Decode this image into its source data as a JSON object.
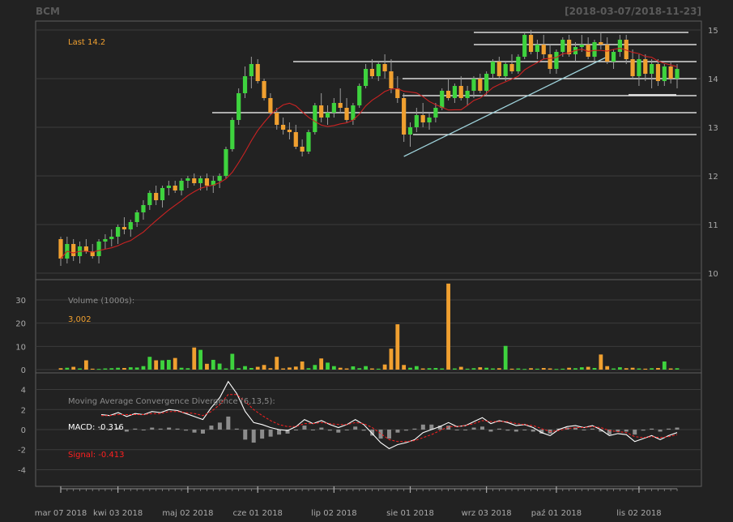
{
  "header": {
    "symbol": "BCM",
    "date_range": "[2018-03-07/2018-11-23]"
  },
  "colors": {
    "background": "#222222",
    "panel_border": "#5f5f5f",
    "grid": "#3c3c3c",
    "up_candle": "#3ed33e",
    "down_candle": "#f0a030",
    "moving_average": "#cc2222",
    "trend_line": "#9fd3dc",
    "level_line": "#ffffff",
    "macd_line": "#ffffff",
    "signal_line": "#ff2020",
    "histogram": "#8c8c8c",
    "axis_text": "#aaaaaa",
    "label_orange": "#f0a030",
    "label_gray": "#8a8a8a",
    "label_red": "#ff2020"
  },
  "chart_data": [
    {
      "type": "candlestick",
      "panel": "price",
      "ylim": [
        9.9,
        15.15
      ],
      "y_ticks": [
        10,
        11,
        12,
        13,
        14,
        15
      ],
      "legend": {
        "last_label": "Last 14.2"
      },
      "series": [
        {
          "name": "price",
          "points": [
            [
              0,
              10.7,
              10.75,
              10.15,
              10.3
            ],
            [
              1,
              10.3,
              10.75,
              10.2,
              10.6
            ],
            [
              2,
              10.6,
              10.7,
              10.25,
              10.35
            ],
            [
              3,
              10.35,
              10.65,
              10.2,
              10.55
            ],
            [
              4,
              10.55,
              10.7,
              10.4,
              10.45
            ],
            [
              5,
              10.45,
              10.6,
              10.3,
              10.35
            ],
            [
              6,
              10.35,
              10.7,
              10.2,
              10.65
            ],
            [
              7,
              10.65,
              10.8,
              10.5,
              10.7
            ],
            [
              8,
              10.7,
              10.9,
              10.55,
              10.75
            ],
            [
              9,
              10.75,
              11.0,
              10.6,
              10.95
            ],
            [
              10,
              10.95,
              11.15,
              10.8,
              10.9
            ],
            [
              11,
              10.9,
              11.1,
              10.75,
              11.05
            ],
            [
              12,
              11.05,
              11.3,
              10.95,
              11.25
            ],
            [
              13,
              11.25,
              11.5,
              11.1,
              11.4
            ],
            [
              14,
              11.4,
              11.7,
              11.3,
              11.65
            ],
            [
              15,
              11.65,
              11.8,
              11.4,
              11.5
            ],
            [
              16,
              11.5,
              11.8,
              11.35,
              11.75
            ],
            [
              17,
              11.75,
              11.9,
              11.6,
              11.8
            ],
            [
              18,
              11.8,
              11.9,
              11.65,
              11.7
            ],
            [
              19,
              11.7,
              11.95,
              11.6,
              11.9
            ],
            [
              20,
              11.9,
              12.0,
              11.75,
              11.95
            ],
            [
              21,
              11.95,
              12.05,
              11.8,
              11.85
            ],
            [
              22,
              11.85,
              12.0,
              11.7,
              11.95
            ],
            [
              23,
              11.95,
              12.05,
              11.7,
              11.8
            ],
            [
              24,
              11.8,
              12.0,
              11.65,
              11.9
            ],
            [
              25,
              11.9,
              12.05,
              11.75,
              12.0
            ],
            [
              26,
              12.0,
              12.6,
              11.95,
              12.55
            ],
            [
              27,
              12.55,
              13.2,
              12.5,
              13.15
            ],
            [
              28,
              13.15,
              13.8,
              13.05,
              13.7
            ],
            [
              29,
              13.7,
              14.25,
              13.6,
              14.05
            ],
            [
              30,
              14.05,
              14.45,
              13.8,
              14.3
            ],
            [
              31,
              14.3,
              14.4,
              13.9,
              13.95
            ],
            [
              32,
              13.95,
              14.0,
              13.55,
              13.6
            ],
            [
              33,
              13.6,
              13.7,
              13.25,
              13.3
            ],
            [
              34,
              13.3,
              13.4,
              12.95,
              13.05
            ],
            [
              35,
              13.05,
              13.2,
              12.85,
              12.95
            ],
            [
              36,
              12.95,
              13.1,
              12.75,
              12.9
            ],
            [
              37,
              12.9,
              13.05,
              12.55,
              12.6
            ],
            [
              38,
              12.6,
              12.75,
              12.4,
              12.5
            ],
            [
              39,
              12.5,
              12.95,
              12.45,
              12.9
            ],
            [
              40,
              12.9,
              13.5,
              12.85,
              13.45
            ],
            [
              41,
              13.45,
              13.7,
              13.1,
              13.2
            ],
            [
              42,
              13.2,
              13.45,
              13.05,
              13.3
            ],
            [
              43,
              13.3,
              13.6,
              13.2,
              13.5
            ],
            [
              44,
              13.5,
              13.8,
              13.3,
              13.4
            ],
            [
              45,
              13.4,
              13.6,
              13.1,
              13.15
            ],
            [
              46,
              13.15,
              13.5,
              13.05,
              13.45
            ],
            [
              47,
              13.45,
              13.9,
              13.4,
              13.85
            ],
            [
              48,
              13.85,
              14.3,
              13.8,
              14.2
            ],
            [
              49,
              14.2,
              14.4,
              14.0,
              14.05
            ],
            [
              50,
              14.05,
              14.35,
              13.95,
              14.3
            ],
            [
              51,
              14.3,
              14.5,
              14.0,
              14.15
            ],
            [
              52,
              14.15,
              14.4,
              13.7,
              13.8
            ],
            [
              53,
              13.8,
              14.05,
              13.5,
              13.6
            ],
            [
              54,
              13.6,
              13.7,
              12.7,
              12.85
            ],
            [
              55,
              12.85,
              13.1,
              12.6,
              13.0
            ],
            [
              56,
              13.0,
              13.4,
              12.9,
              13.25
            ],
            [
              57,
              13.25,
              13.5,
              13.0,
              13.1
            ],
            [
              58,
              13.1,
              13.3,
              12.95,
              13.2
            ],
            [
              59,
              13.2,
              13.5,
              13.1,
              13.4
            ],
            [
              60,
              13.4,
              13.8,
              13.35,
              13.75
            ],
            [
              61,
              13.75,
              14.0,
              13.55,
              13.6
            ],
            [
              62,
              13.6,
              13.9,
              13.5,
              13.85
            ],
            [
              63,
              13.85,
              14.05,
              13.55,
              13.6
            ],
            [
              64,
              13.6,
              13.85,
              13.45,
              13.75
            ],
            [
              65,
              13.75,
              14.05,
              13.6,
              14.0
            ],
            [
              66,
              14.0,
              14.1,
              13.7,
              13.75
            ],
            [
              67,
              13.75,
              14.15,
              13.65,
              14.1
            ],
            [
              68,
              14.1,
              14.4,
              14.0,
              14.35
            ],
            [
              69,
              14.35,
              14.45,
              14.0,
              14.05
            ],
            [
              70,
              14.05,
              14.35,
              13.95,
              14.3
            ],
            [
              71,
              14.3,
              14.5,
              14.1,
              14.15
            ],
            [
              72,
              14.15,
              14.5,
              14.1,
              14.45
            ],
            [
              73,
              14.45,
              14.95,
              14.4,
              14.9
            ],
            [
              74,
              14.9,
              15.0,
              14.5,
              14.55
            ],
            [
              75,
              14.55,
              14.8,
              14.4,
              14.7
            ],
            [
              76,
              14.7,
              14.9,
              14.4,
              14.5
            ],
            [
              77,
              14.5,
              14.7,
              14.1,
              14.2
            ],
            [
              78,
              14.2,
              14.6,
              14.1,
              14.55
            ],
            [
              79,
              14.55,
              14.85,
              14.45,
              14.8
            ],
            [
              80,
              14.8,
              14.9,
              14.45,
              14.5
            ],
            [
              81,
              14.5,
              14.75,
              14.35,
              14.65
            ],
            [
              82,
              14.65,
              14.9,
              14.55,
              14.7
            ],
            [
              83,
              14.7,
              14.85,
              14.4,
              14.45
            ],
            [
              84,
              14.45,
              14.8,
              14.35,
              14.75
            ],
            [
              85,
              14.75,
              14.95,
              14.6,
              14.7
            ],
            [
              86,
              14.7,
              14.85,
              14.3,
              14.35
            ],
            [
              87,
              14.35,
              14.6,
              14.2,
              14.55
            ],
            [
              88,
              14.55,
              14.9,
              14.45,
              14.8
            ],
            [
              89,
              14.8,
              14.9,
              14.3,
              14.4
            ],
            [
              90,
              14.4,
              14.6,
              14.0,
              14.05
            ],
            [
              91,
              14.05,
              14.5,
              13.85,
              14.4
            ],
            [
              92,
              14.4,
              14.5,
              13.95,
              14.1
            ],
            [
              93,
              14.1,
              14.4,
              13.8,
              14.3
            ],
            [
              94,
              14.3,
              14.4,
              13.85,
              13.95
            ],
            [
              95,
              13.95,
              14.3,
              13.85,
              14.25
            ],
            [
              96,
              14.25,
              14.35,
              13.9,
              14.0
            ],
            [
              97,
              14.0,
              14.3,
              13.8,
              14.2
            ]
          ]
        },
        {
          "name": "moving average",
          "style": "line"
        }
      ],
      "annotations": {
        "support_resistance_levels": [
          12.85,
          13.3,
          13.65,
          14.0,
          14.35,
          14.7,
          14.95
        ],
        "trend_line": {
          "from": [
            54,
            12.4
          ],
          "to": [
            86,
            14.45
          ]
        }
      }
    },
    {
      "type": "bar",
      "panel": "volume",
      "ylim": [
        0,
        38
      ],
      "y_ticks": [
        0,
        10,
        20,
        30
      ],
      "legend": {
        "label": "Volume (1000s):",
        "last_value": "3,002"
      },
      "values": [
        0.6,
        0.8,
        1.2,
        0.5,
        4.0,
        0.4,
        0.3,
        0.5,
        0.6,
        0.8,
        0.7,
        1.0,
        0.9,
        1.5,
        5.5,
        4.0,
        4.0,
        4.2,
        5.0,
        0.8,
        0.6,
        9.5,
        8.5,
        2.5,
        4.2,
        2.6,
        0.5,
        6.8,
        0.6,
        1.5,
        0.7,
        1.2,
        2.0,
        0.6,
        5.5,
        0.5,
        0.9,
        1.3,
        3.5,
        0.6,
        2.0,
        4.8,
        3.0,
        1.5,
        0.8,
        0.5,
        1.4,
        0.6,
        1.5,
        0.5,
        0.4,
        2.2,
        9.0,
        19.5,
        2.0,
        0.8,
        1.5,
        0.5,
        0.6,
        0.7,
        0.5,
        37.0,
        0.5,
        1.2,
        0.4,
        0.6,
        1.0,
        0.8,
        0.5,
        0.6,
        10.2,
        0.4,
        0.5,
        0.3,
        0.6,
        0.4,
        0.7,
        0.5,
        0.3,
        0.4,
        0.8,
        0.6,
        1.0,
        1.2,
        0.7,
        6.5,
        1.5,
        0.5,
        1.0,
        0.6,
        0.8,
        0.5,
        0.4,
        0.6,
        0.7,
        3.5,
        0.5,
        0.6
      ]
    },
    {
      "type": "line",
      "panel": "macd",
      "ylim": [
        -5.5,
        5.5
      ],
      "y_ticks": [
        -4,
        -2,
        0,
        2,
        4
      ],
      "legend": {
        "title": "Moving Average Convergence Divergence (6,13,5):",
        "macd_label": "MACD: -0.316",
        "signal_label": "Signal: -0.413"
      },
      "series": [
        {
          "name": "MACD",
          "values": [
            1.5,
            1.4,
            1.7,
            1.3,
            1.6,
            1.5,
            1.8,
            1.7,
            2.0,
            1.9,
            1.6,
            1.3,
            1.0,
            2.2,
            3.2,
            4.8,
            3.6,
            1.8,
            0.7,
            0.5,
            0.2,
            0.0,
            -0.1,
            0.3,
            1.0,
            0.6,
            0.9,
            0.5,
            0.2,
            0.5,
            1.0,
            0.5,
            -0.4,
            -1.3,
            -1.9,
            -1.5,
            -1.3,
            -1.0,
            -0.3,
            0.0,
            0.3,
            0.7,
            0.3,
            0.4,
            0.8,
            1.2,
            0.6,
            0.9,
            0.7,
            0.4,
            0.5,
            0.2,
            -0.3,
            -0.6,
            0.0,
            0.3,
            0.4,
            0.2,
            0.4,
            0.0,
            -0.6,
            -0.4,
            -0.5,
            -1.2,
            -0.9,
            -0.6,
            -1.0,
            -0.6,
            -0.3
          ]
        },
        {
          "name": "Signal",
          "values": [
            1.4,
            1.4,
            1.5,
            1.5,
            1.5,
            1.5,
            1.6,
            1.6,
            1.8,
            1.8,
            1.7,
            1.6,
            1.4,
            1.8,
            2.5,
            3.5,
            3.5,
            2.8,
            2.0,
            1.4,
            0.9,
            0.5,
            0.3,
            0.3,
            0.6,
            0.6,
            0.7,
            0.6,
            0.5,
            0.5,
            0.7,
            0.6,
            0.2,
            -0.4,
            -1.0,
            -1.2,
            -1.2,
            -1.1,
            -0.8,
            -0.5,
            -0.1,
            0.3,
            0.3,
            0.4,
            0.6,
            0.9,
            0.8,
            0.8,
            0.8,
            0.6,
            0.5,
            0.4,
            0.1,
            -0.2,
            -0.1,
            0.1,
            0.2,
            0.2,
            0.3,
            0.2,
            -0.1,
            -0.2,
            -0.3,
            -0.7,
            -0.8,
            -0.7,
            -0.8,
            -0.7,
            -0.5
          ]
        }
      ]
    }
  ],
  "x_axis": {
    "labels": [
      "mar 07 2018",
      "kwi 03 2018",
      "maj 02 2018",
      "cze 01 2018",
      "lip 02 2018",
      "sie 01 2018",
      "wrz 03 2018",
      "paź 01 2018",
      "lis 02 2018"
    ],
    "label_positions_index": [
      0,
      9,
      20,
      31,
      43,
      55,
      67,
      78,
      91
    ]
  }
}
